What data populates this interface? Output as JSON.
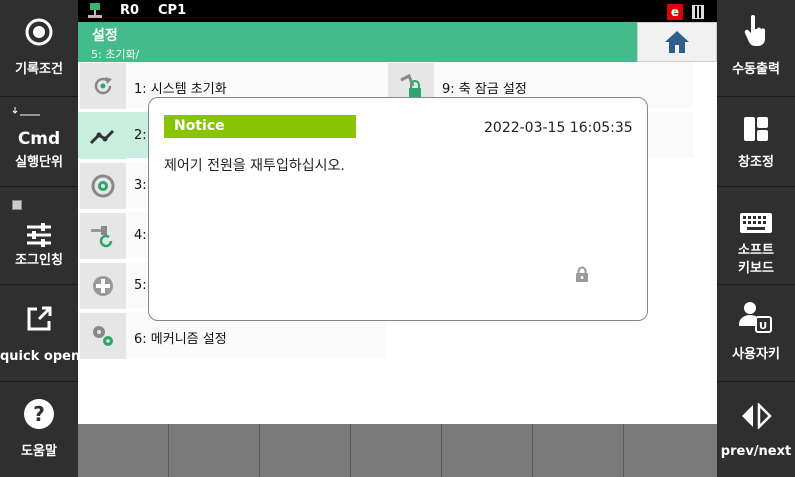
{
  "status": {
    "robot": "R0",
    "cp": "CP1",
    "badge": "e"
  },
  "title": {
    "main": "설정",
    "path": "5: 초기화/"
  },
  "left_buttons": [
    {
      "label": "기록조건",
      "icon": "record-circle-icon"
    },
    {
      "label": "실행단위",
      "icon": "cmd-icon",
      "sub": "Cmd"
    },
    {
      "label": "조그인칭",
      "icon": "sliders-icon"
    },
    {
      "label": "quick open",
      "icon": "external-link-icon"
    },
    {
      "label": "도움말",
      "icon": "help-icon"
    }
  ],
  "right_buttons": [
    {
      "label": "수동출력",
      "icon": "hand-pointer-icon"
    },
    {
      "label": "창조정",
      "icon": "window-layout-icon"
    },
    {
      "label1": "소프트",
      "label2": "키보드",
      "icon": "keyboard-icon"
    },
    {
      "label": "사용자키",
      "icon": "user-key-icon",
      "sub": "U"
    },
    {
      "label": "prev/next",
      "icon": "prev-next-icon"
    }
  ],
  "items_left": [
    {
      "label": "1: 시스템 초기화",
      "icon": "system-reset-icon"
    },
    {
      "label": "2:",
      "icon": "robot-arm-icon"
    },
    {
      "label": "3:",
      "icon": "gear-circle-icon"
    },
    {
      "label": "4:",
      "icon": "tool-reset-icon"
    },
    {
      "label": "5:",
      "icon": "plus-circle-icon"
    },
    {
      "label": "6: 메커니즘 설정",
      "icon": "gears-icon"
    }
  ],
  "items_right": [
    {
      "label": "9: 축 잠금 설정",
      "icon": "axis-lock-icon"
    }
  ],
  "dialog": {
    "title": "Notice",
    "datetime": "2022-03-15  16:05:35",
    "message": "제어기 전원을 재투입하십시오."
  },
  "colors": {
    "accent": "#44bb8a",
    "notice": "#88c500",
    "side": "#2f2f2f"
  }
}
